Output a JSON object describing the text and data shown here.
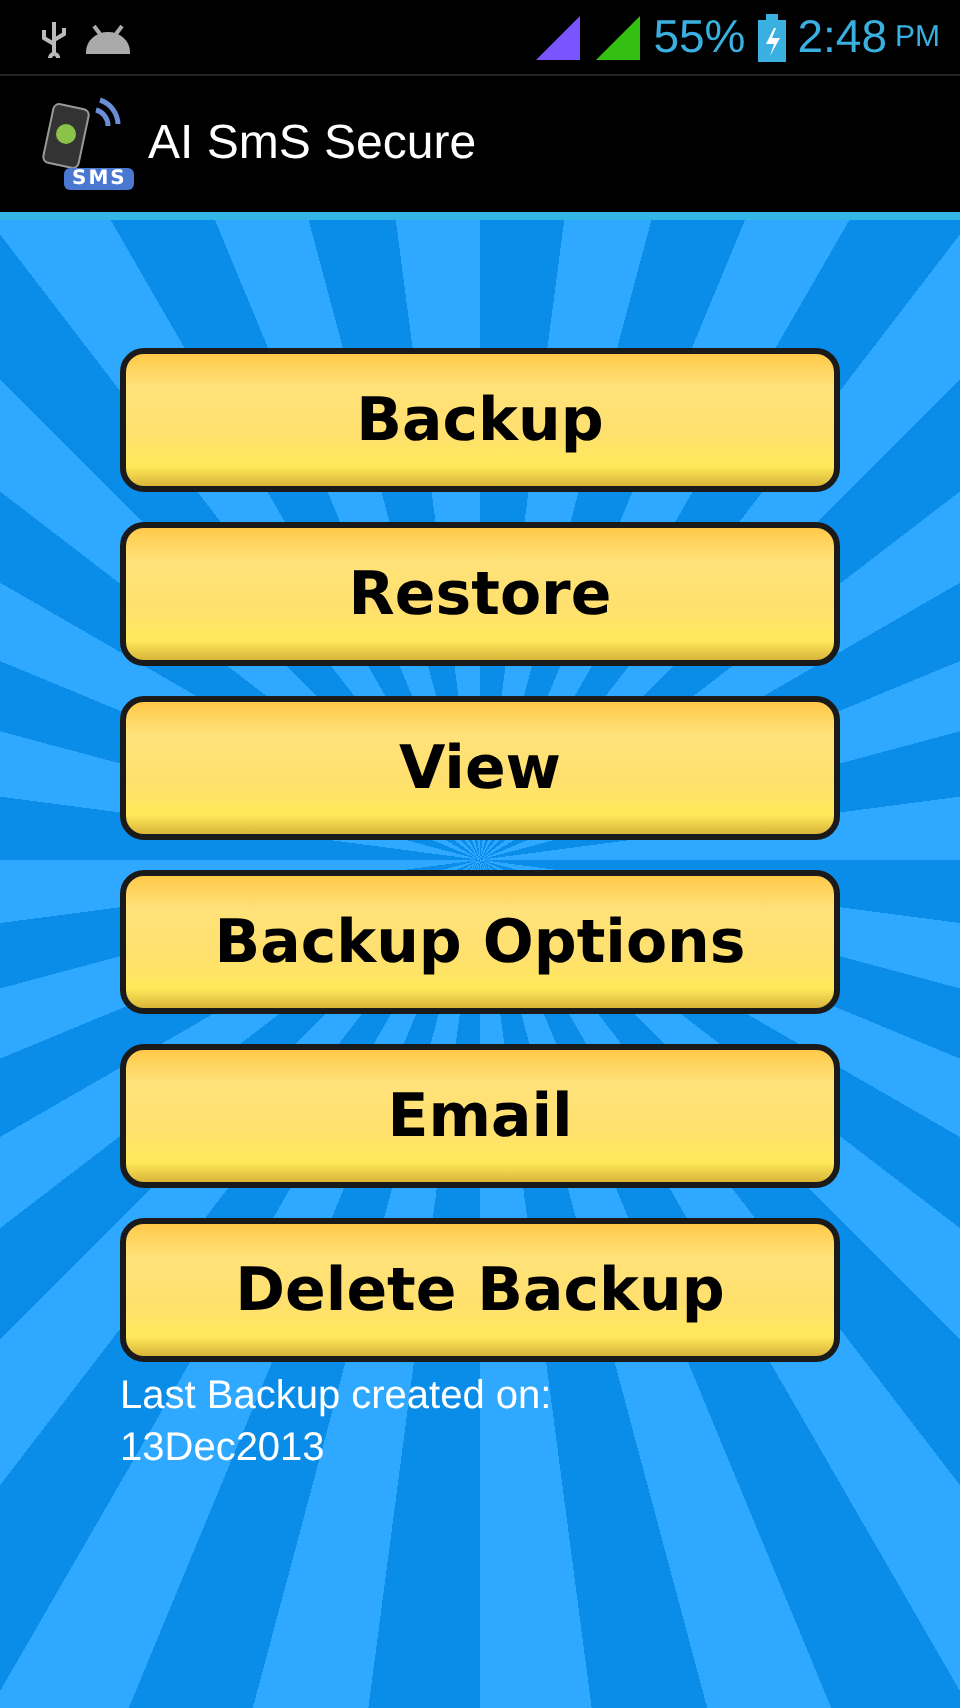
{
  "status_bar": {
    "battery_percent": "55%",
    "time": "2:48",
    "ampm": "PM"
  },
  "app_bar": {
    "title": "AI SmS Secure",
    "icon_label": "SMS"
  },
  "buttons": [
    "Backup",
    "Restore",
    "View",
    "Backup Options",
    "Email",
    "Delete Backup"
  ],
  "footer": {
    "line_1": "Last Backup created on:",
    "line_2": "13Dec2013"
  }
}
